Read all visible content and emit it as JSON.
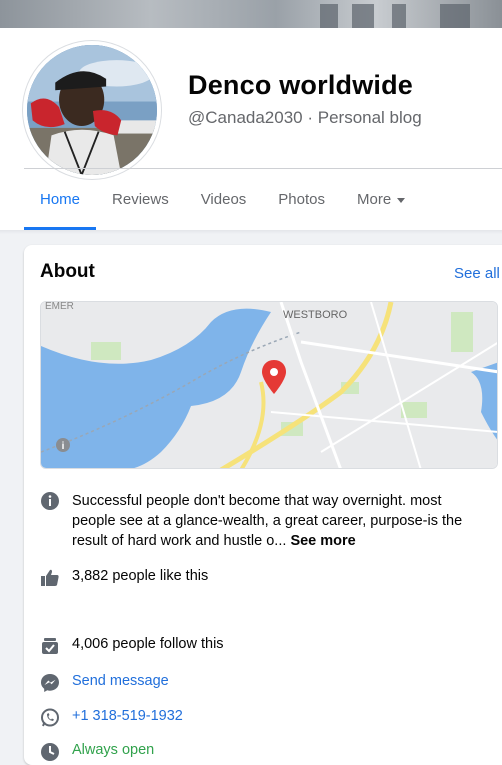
{
  "page": {
    "name": "Denco worldwide",
    "handle": "@Canada2030 · Personal blog"
  },
  "tabs": [
    {
      "label": "Home"
    },
    {
      "label": "Reviews"
    },
    {
      "label": "Videos"
    },
    {
      "label": "Photos"
    },
    {
      "label": "More"
    }
  ],
  "about": {
    "title": "About",
    "see_all": "See all",
    "map": {
      "labels": [
        "EMER",
        "WESTBORO"
      ],
      "info_label": "i"
    },
    "description": "Successful people don't become that way overnight. most people see at a glance-wealth, a great career, purpose-is the result of hard work and hustle o...",
    "see_more": "See more",
    "likes": "3,882 people like this",
    "follows": "4,006 people follow this",
    "send_message": "Send message",
    "phone": "+1 318-519-1932",
    "hours": "Always open"
  },
  "colors": {
    "accent": "#1877f2",
    "link": "#216fdb",
    "open": "#31a24c",
    "pin": "#e53935"
  }
}
